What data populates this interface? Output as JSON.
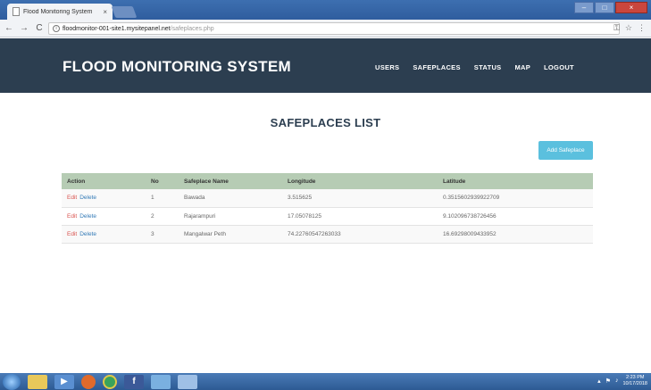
{
  "browser": {
    "tab_title": "Flood Monitoring System",
    "url_host": "floodmonitor-001-site1.mysitepanel.net",
    "url_path": "/safeplaces.php"
  },
  "site": {
    "brand": "FLOOD MONITORING SYSTEM",
    "nav": [
      "USERS",
      "SAFEPLACES",
      "STATUS",
      "MAP",
      "LOGOUT"
    ]
  },
  "page": {
    "title": "SAFEPLACES LIST",
    "add_button": "Add Safeplace"
  },
  "table": {
    "headers": [
      "Action",
      "No",
      "Safeplace Name",
      "Longitude",
      "Latitude"
    ],
    "edit_label": "Edit",
    "delete_label": "Delete",
    "rows": [
      {
        "no": "1",
        "name": "Bawada",
        "longitude": "3.515625",
        "latitude": "0.3515602939922709"
      },
      {
        "no": "2",
        "name": "Rajarampuri",
        "longitude": "17.05078125",
        "latitude": "9.102096738726456"
      },
      {
        "no": "3",
        "name": "Mangalwar Peth",
        "longitude": "74.22760547263033",
        "latitude": "16.69298009433952"
      }
    ]
  },
  "taskbar": {
    "time": "2:23 PM",
    "date": "10/17/2018"
  }
}
